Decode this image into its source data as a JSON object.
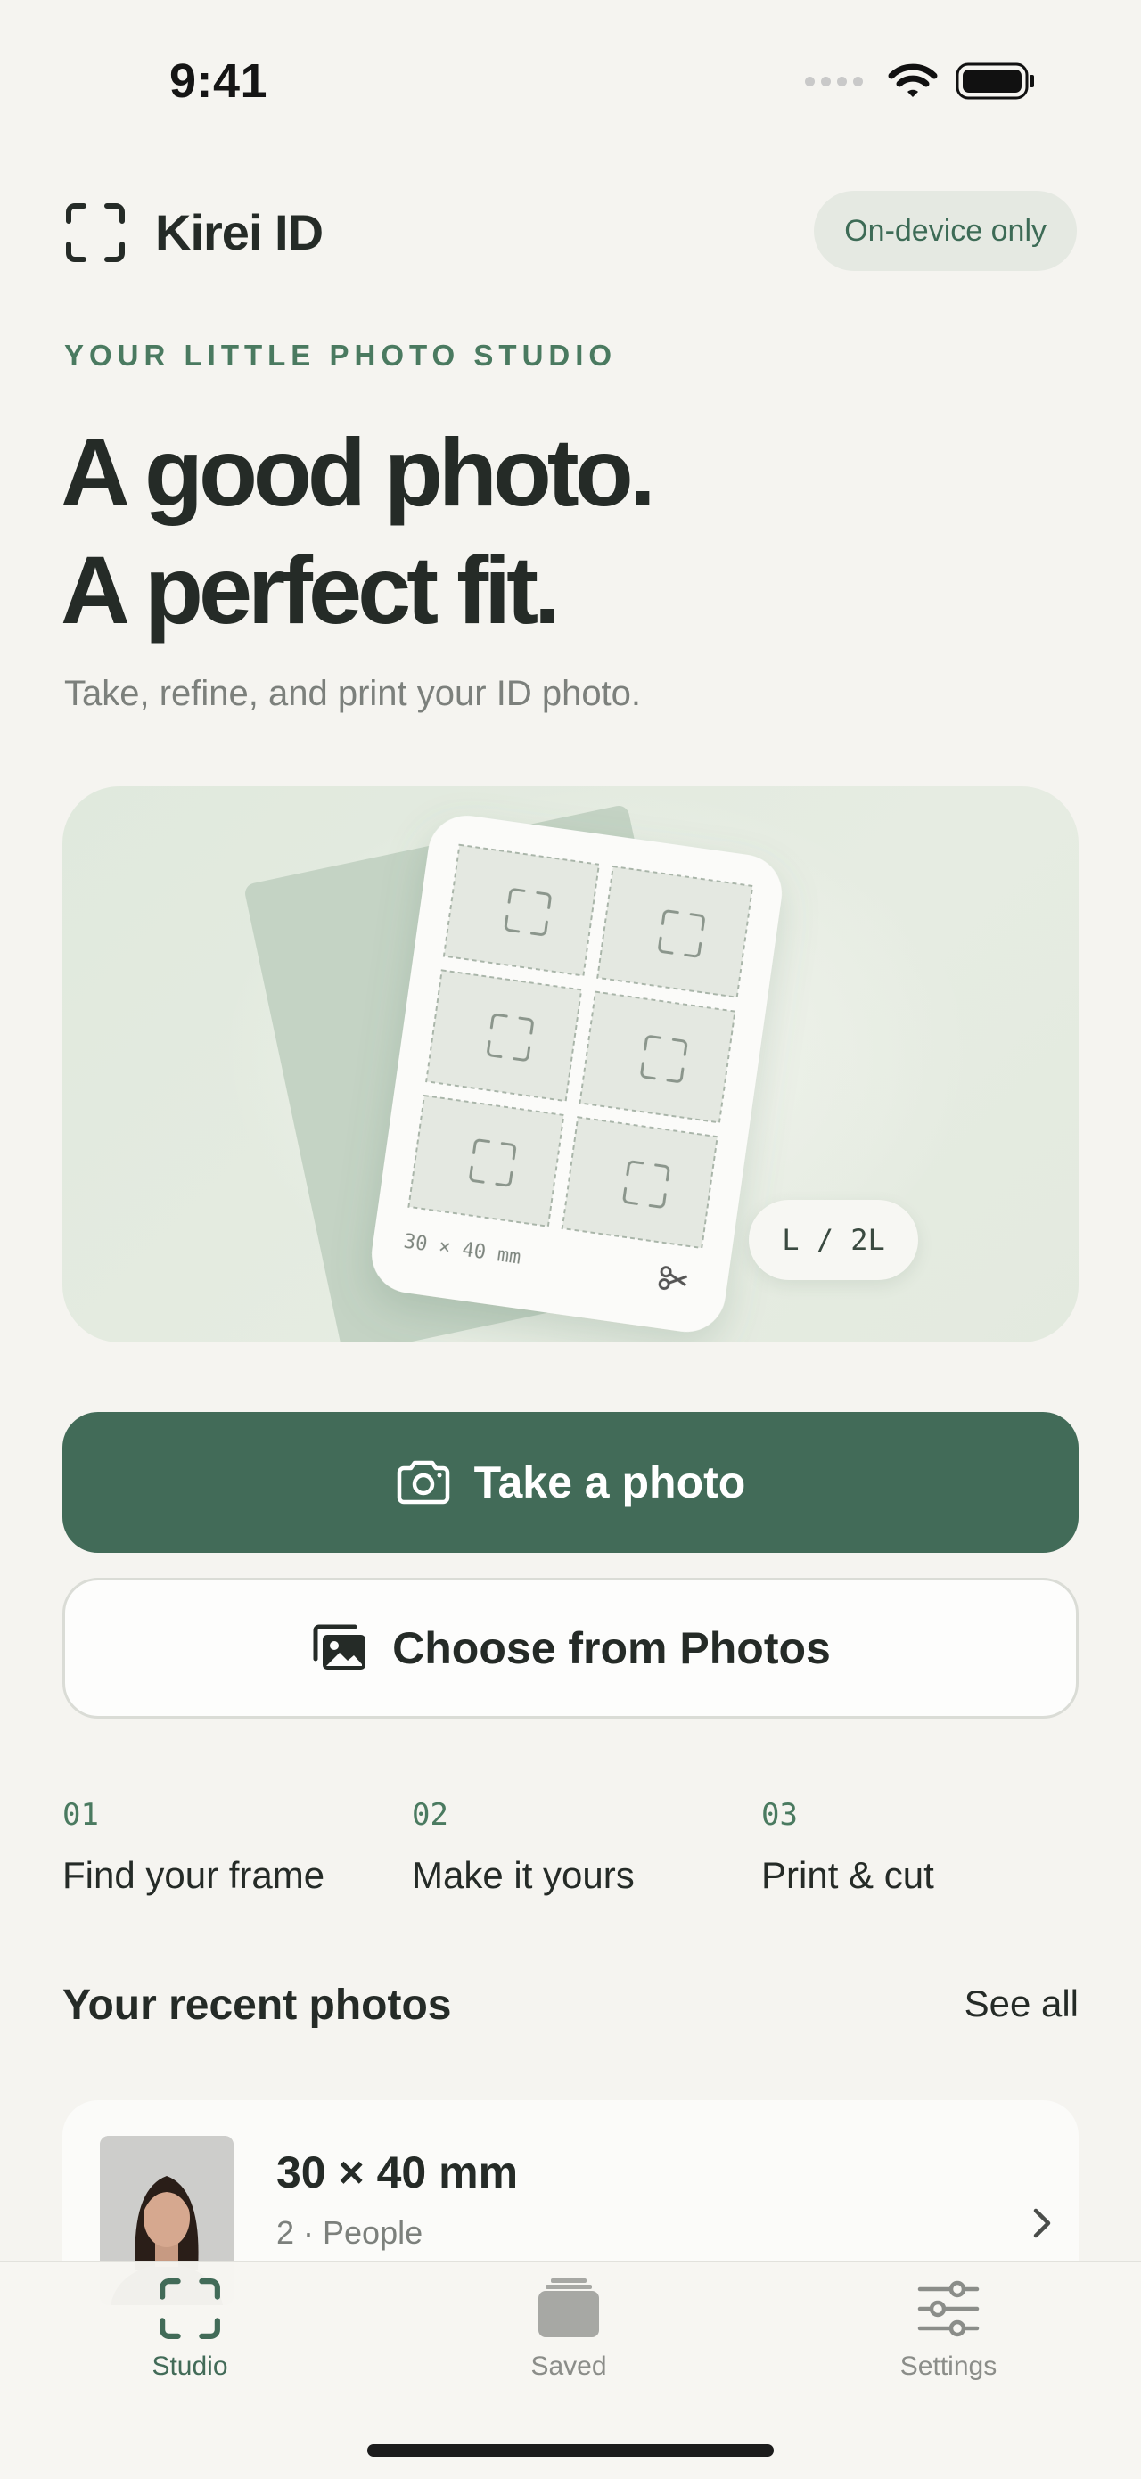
{
  "status_bar": {
    "time": "9:41"
  },
  "header": {
    "app_name": "Kirei ID",
    "badge": "On-device only"
  },
  "hero": {
    "eyebrow": "YOUR LITTLE PHOTO STUDIO",
    "headline_line1": "A good photo.",
    "headline_line2": "A perfect fit.",
    "subtitle": "Take, refine, and print your ID photo.",
    "sheet_size": "30 × 40 mm",
    "paper_size": "L / 2L"
  },
  "actions": {
    "primary": "Take a photo",
    "secondary": "Choose from Photos"
  },
  "steps": [
    {
      "num": "01",
      "label": "Find your frame"
    },
    {
      "num": "02",
      "label": "Make it yours"
    },
    {
      "num": "03",
      "label": "Print & cut"
    }
  ],
  "recent": {
    "title": "Your recent photos",
    "see_all": "See all",
    "items": [
      {
        "title": "30 × 40 mm",
        "meta": "2 · People"
      }
    ]
  },
  "tabs": [
    {
      "label": "Studio",
      "active": true
    },
    {
      "label": "Saved",
      "active": false
    },
    {
      "label": "Settings",
      "active": false
    }
  ],
  "colors": {
    "accent": "#426b58",
    "background": "#f5f4f0",
    "badge_bg": "#e5e9e2",
    "hero_bg": "#e3eadf",
    "inactive": "#8b8d89"
  },
  "icons": {
    "logo": "viewfinder-icon",
    "primary": "camera-icon",
    "secondary": "photos-icon",
    "sheet_cut": "scissors-icon",
    "row": "chevron-right-icon",
    "tabs": [
      "viewfinder-icon",
      "stack-icon",
      "sliders-icon"
    ]
  }
}
